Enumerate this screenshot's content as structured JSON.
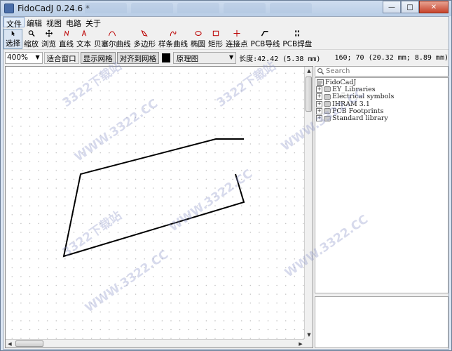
{
  "window": {
    "title": "FidoCadJ 0.24.6  *",
    "buttons": {
      "minimize": "—",
      "maximize": "□",
      "close": "✕"
    }
  },
  "menu": [
    {
      "label": "文件",
      "active": true
    },
    {
      "label": "编辑"
    },
    {
      "label": "视图"
    },
    {
      "label": "电路"
    },
    {
      "label": "关于"
    }
  ],
  "toolbar": [
    {
      "label": "选择",
      "icon": "pointer-arrow-icon",
      "active": true
    },
    {
      "label": "缩放",
      "icon": "zoom-magnifier-icon"
    },
    {
      "label": "浏览",
      "icon": "pan-hand-icon"
    },
    {
      "label": "直线",
      "icon": "line-icon"
    },
    {
      "label": "文本",
      "icon": "text-icon"
    },
    {
      "label": "贝塞尔曲线",
      "icon": "bezier-curve-icon"
    },
    {
      "label": "多边形",
      "icon": "polygon-icon"
    },
    {
      "label": "样条曲线",
      "icon": "spline-icon"
    },
    {
      "label": "椭圆",
      "icon": "ellipse-icon"
    },
    {
      "label": "矩形",
      "icon": "rectangle-icon"
    },
    {
      "label": "连接点",
      "icon": "connection-point-icon"
    },
    {
      "label": "PCB导线",
      "icon": "pcb-track-icon"
    },
    {
      "label": "PCB焊盘",
      "icon": "pcb-pad-icon"
    }
  ],
  "options": {
    "zoom": "400%",
    "fit_window": "适合窗口",
    "show_grid": "显示网格",
    "snap_grid": "对齐到网格",
    "layer": "原理图",
    "length": "长度:42.42 (5.38 mm)",
    "coords": "160; 70 (20.32 mm; 8.89 mm)"
  },
  "library": {
    "search_placeholder": "Search",
    "root": "FidoCadJ",
    "items": [
      "EY_Libraries",
      "Electrical symbols",
      "IHRAM 3.1",
      "PCB Footprints",
      "Standard library"
    ]
  },
  "watermarks": [
    "3322下载站",
    "WWW.3322.CC",
    "3322下载站",
    "WWW.3322.CC",
    "3322下载站",
    "WWW.3322.CC",
    "WWW.3322.CC",
    "WWW.3322.CC"
  ]
}
